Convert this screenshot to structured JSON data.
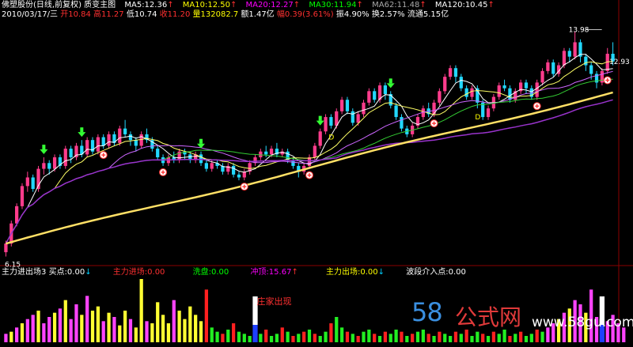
{
  "header": {
    "title": "佛塑股份(日线,前复权) 质变主图",
    "ma5": "MA5:12.36",
    "ma10": "MA10:12.50",
    "ma20": "MA20:12.27",
    "ma30": "MA30:11.94",
    "ma62": "MA62:11.48",
    "ma120": "MA120:10.45",
    "up_arrow": "↑",
    "colors": {
      "ma5": "#ffffff",
      "ma10": "#ffff00",
      "ma20": "#ff00ff",
      "ma30": "#00ff00",
      "ma62": "#888888",
      "ma120": "#ffffff"
    }
  },
  "quote": {
    "date": "2010/03/17/三",
    "open": "开10.84",
    "high": "高11.27",
    "low": "低10.74",
    "close": "收11.20",
    "volume": "量132082.7",
    "amount": "额1.47亿",
    "change": "幅0.39(3.61%)",
    "amplitude": "振4.90%",
    "turnover": "换2.57%",
    "float": "流通5.15亿"
  },
  "indicator": {
    "name": "主力进出场3",
    "buy": "买点:0.00",
    "main_in": "主力进场:0.00",
    "wash": "洗盘:0.00",
    "rush": "冲顶:15.67",
    "main_out": "主力出场:0.00",
    "band": "波段介入点:0.00",
    "down_arrow": "↓",
    "up_arrow": "↑",
    "annotation": "庄家出现",
    "colors": {
      "main_in": "#ff3030",
      "wash": "#00ff00",
      "rush": "#ff00ff",
      "main_out": "#ffff00",
      "band": "#ffffff"
    }
  },
  "watermark": {
    "num": "58",
    "cn": "公式网",
    "url": "www.58gu.com"
  },
  "chart_data": {
    "type": "candlestick",
    "price_labels": {
      "high": "13.98",
      "last": "12.93",
      "low": "6.15"
    },
    "marker_letter": "D",
    "ylim": [
      6.0,
      14.3
    ],
    "candles": [
      [
        6.3,
        6.6,
        6.15,
        6.7
      ],
      [
        6.6,
        7.3,
        6.5,
        7.4
      ],
      [
        7.3,
        7.9,
        7.2,
        8.0
      ],
      [
        7.9,
        8.6,
        7.8,
        8.7
      ],
      [
        8.6,
        8.9,
        8.4,
        9.1
      ],
      [
        8.9,
        8.5,
        8.4,
        9.0
      ],
      [
        8.5,
        9.2,
        8.4,
        9.3
      ],
      [
        9.2,
        9.4,
        9.0,
        9.6
      ],
      [
        9.4,
        9.2,
        9.0,
        9.5
      ],
      [
        9.2,
        9.6,
        9.1,
        9.7
      ],
      [
        9.6,
        9.3,
        9.2,
        9.7
      ],
      [
        9.3,
        9.9,
        9.2,
        10.0
      ],
      [
        9.9,
        9.6,
        9.4,
        10.0
      ],
      [
        9.6,
        10.0,
        9.5,
        10.1
      ],
      [
        10.0,
        9.7,
        9.6,
        10.2
      ],
      [
        9.7,
        10.2,
        9.6,
        10.3
      ],
      [
        10.2,
        9.8,
        9.7,
        10.3
      ],
      [
        9.8,
        10.3,
        9.7,
        10.4
      ],
      [
        10.3,
        10.0,
        9.9,
        10.4
      ],
      [
        10.0,
        10.4,
        9.9,
        10.5
      ],
      [
        10.4,
        10.1,
        10.0,
        10.5
      ],
      [
        10.1,
        10.6,
        10.0,
        10.7
      ],
      [
        10.6,
        10.4,
        10.3,
        10.9
      ],
      [
        10.4,
        10.2,
        10.0,
        10.5
      ],
      [
        10.2,
        10.0,
        9.8,
        10.3
      ],
      [
        10.0,
        10.4,
        9.9,
        10.5
      ],
      [
        10.4,
        10.2,
        10.1,
        10.6
      ],
      [
        10.2,
        9.9,
        9.8,
        10.3
      ],
      [
        9.9,
        9.6,
        9.5,
        10.0
      ],
      [
        9.6,
        9.4,
        9.3,
        9.7
      ],
      [
        9.4,
        9.6,
        9.3,
        9.7
      ],
      [
        9.6,
        9.5,
        9.4,
        9.8
      ],
      [
        9.5,
        9.8,
        9.4,
        9.9
      ],
      [
        9.8,
        9.7,
        9.5,
        9.9
      ],
      [
        9.7,
        9.5,
        9.4,
        9.8
      ],
      [
        9.5,
        9.7,
        9.4,
        9.8
      ],
      [
        9.7,
        9.4,
        9.3,
        9.8
      ],
      [
        9.4,
        9.2,
        9.1,
        9.5
      ],
      [
        9.2,
        9.4,
        9.1,
        9.5
      ],
      [
        9.4,
        9.3,
        9.2,
        9.5
      ],
      [
        9.3,
        9.1,
        9.0,
        9.4
      ],
      [
        9.1,
        9.3,
        9.0,
        9.4
      ],
      [
        9.3,
        9.0,
        8.9,
        9.4
      ],
      [
        9.0,
        8.9,
        8.8,
        9.1
      ],
      [
        8.9,
        9.1,
        8.8,
        9.2
      ],
      [
        9.1,
        9.4,
        9.0,
        9.5
      ],
      [
        9.4,
        9.6,
        9.3,
        9.7
      ],
      [
        9.6,
        9.8,
        9.5,
        9.9
      ],
      [
        9.8,
        9.7,
        9.6,
        10.0
      ],
      [
        9.7,
        9.9,
        9.6,
        10.0
      ],
      [
        9.9,
        9.7,
        9.6,
        10.1
      ],
      [
        9.7,
        9.8,
        9.6,
        9.9
      ],
      [
        9.8,
        9.5,
        9.4,
        9.9
      ],
      [
        9.5,
        9.3,
        9.2,
        9.6
      ],
      [
        9.3,
        9.1,
        8.9,
        9.4
      ],
      [
        9.1,
        9.3,
        9.0,
        9.4
      ],
      [
        9.3,
        9.6,
        9.2,
        9.7
      ],
      [
        9.6,
        10.0,
        9.5,
        10.1
      ],
      [
        10.0,
        10.5,
        9.9,
        10.6
      ],
      [
        10.5,
        11.0,
        10.4,
        11.1
      ],
      [
        11.0,
        10.7,
        10.6,
        11.1
      ],
      [
        10.7,
        11.2,
        10.6,
        11.3
      ],
      [
        11.2,
        11.6,
        11.1,
        11.7
      ],
      [
        11.6,
        11.2,
        11.1,
        11.7
      ],
      [
        11.2,
        10.8,
        10.7,
        11.3
      ],
      [
        10.8,
        11.1,
        10.7,
        11.2
      ],
      [
        11.1,
        11.5,
        11.0,
        11.6
      ],
      [
        11.5,
        11.9,
        11.4,
        12.0
      ],
      [
        11.9,
        11.6,
        11.5,
        12.0
      ],
      [
        11.6,
        12.1,
        11.5,
        12.2
      ],
      [
        12.1,
        11.8,
        11.6,
        12.2
      ],
      [
        11.8,
        11.4,
        11.3,
        11.9
      ],
      [
        11.4,
        11.0,
        10.9,
        11.5
      ],
      [
        11.0,
        10.6,
        10.5,
        11.1
      ],
      [
        10.6,
        10.4,
        10.3,
        10.7
      ],
      [
        10.4,
        10.7,
        10.3,
        10.8
      ],
      [
        10.7,
        11.0,
        10.6,
        11.1
      ],
      [
        11.0,
        11.3,
        10.9,
        11.4
      ],
      [
        11.3,
        11.1,
        11.0,
        11.5
      ],
      [
        11.1,
        11.5,
        11.0,
        11.6
      ],
      [
        11.5,
        11.9,
        11.4,
        12.0
      ],
      [
        11.9,
        12.4,
        11.8,
        12.5
      ],
      [
        12.4,
        12.7,
        12.3,
        12.8
      ],
      [
        12.7,
        12.4,
        12.2,
        12.8
      ],
      [
        12.4,
        12.0,
        11.9,
        12.5
      ],
      [
        12.0,
        11.7,
        11.6,
        12.1
      ],
      [
        11.7,
        12.0,
        11.6,
        12.1
      ],
      [
        12.0,
        11.5,
        11.3,
        12.1
      ],
      [
        11.5,
        11.0,
        10.9,
        11.6
      ],
      [
        11.0,
        11.3,
        10.9,
        11.4
      ],
      [
        11.3,
        11.7,
        11.2,
        11.8
      ],
      [
        11.7,
        12.1,
        11.6,
        12.2
      ],
      [
        12.1,
        12.0,
        11.9,
        12.3
      ],
      [
        12.0,
        11.6,
        11.5,
        12.1
      ],
      [
        11.6,
        11.9,
        11.5,
        12.0
      ],
      [
        11.9,
        12.2,
        11.8,
        12.3
      ],
      [
        12.2,
        12.0,
        11.8,
        12.3
      ],
      [
        12.0,
        11.7,
        11.6,
        12.1
      ],
      [
        11.7,
        12.2,
        11.6,
        12.3
      ],
      [
        12.2,
        12.6,
        12.1,
        12.7
      ],
      [
        12.6,
        12.9,
        12.5,
        13.0
      ],
      [
        12.9,
        12.5,
        12.4,
        13.0
      ],
      [
        12.5,
        12.8,
        12.4,
        12.9
      ],
      [
        12.8,
        13.3,
        12.7,
        13.4
      ],
      [
        13.3,
        13.1,
        12.9,
        13.4
      ],
      [
        13.1,
        13.6,
        13.0,
        13.98
      ],
      [
        13.6,
        13.1,
        12.9,
        13.7
      ],
      [
        13.1,
        12.8,
        12.6,
        13.2
      ],
      [
        12.8,
        12.5,
        12.3,
        12.9
      ],
      [
        12.5,
        12.2,
        12.0,
        12.6
      ],
      [
        12.2,
        12.6,
        12.1,
        12.7
      ],
      [
        12.6,
        13.2,
        12.5,
        13.4
      ],
      [
        13.2,
        12.93,
        12.8,
        13.6
      ]
    ],
    "main_in_idx": [
      7,
      14,
      36,
      58,
      71
    ],
    "rush_idx": [
      66,
      80
    ],
    "volume_colors": [
      "magenta",
      "yellow",
      "magenta",
      "yellow",
      "magenta",
      "magenta",
      "yellow",
      "magenta",
      "magenta",
      "yellow",
      "magenta",
      "yellow",
      "magenta",
      "magenta",
      "yellow",
      "magenta",
      "yellow",
      "yellow",
      "magenta",
      "yellow",
      "magenta",
      "yellow",
      "yellow",
      "magenta",
      "yellow",
      "yellow",
      "magenta",
      "yellow",
      "yellow",
      "yellow",
      "yellow",
      "magenta",
      "yellow",
      "yellow",
      "yellow",
      "yellow",
      "yellow",
      "red",
      "green",
      "green",
      "red",
      "green",
      "red",
      "green",
      "green",
      "green",
      "red",
      "green",
      "red",
      "green",
      "green",
      "red",
      "green",
      "red",
      "green",
      "red",
      "green",
      "red",
      "green",
      "green",
      "red",
      "green",
      "green",
      "red",
      "green",
      "red",
      "green",
      "green",
      "red",
      "green",
      "red",
      "green",
      "green",
      "red",
      "green",
      "red",
      "green",
      "green",
      "red",
      "green",
      "red",
      "green",
      "green",
      "red",
      "green",
      "red",
      "green",
      "green",
      "red",
      "green",
      "red",
      "green",
      "green",
      "red",
      "green",
      "red",
      "green",
      "green",
      "red",
      "green",
      "magenta",
      "magenta",
      "yellow",
      "magenta",
      "yellow",
      "magenta",
      "magenta",
      "yellow",
      "magenta",
      "magenta",
      "yellow",
      "magenta",
      "magenta"
    ],
    "volume_values": [
      8,
      10,
      14,
      18,
      22,
      26,
      30,
      18,
      24,
      28,
      32,
      40,
      22,
      36,
      26,
      44,
      30,
      34,
      20,
      28,
      24,
      16,
      30,
      22,
      14,
      60,
      20,
      18,
      38,
      26,
      18,
      40,
      30,
      22,
      34,
      26,
      20,
      50,
      14,
      10,
      8,
      12,
      18,
      10,
      8,
      6,
      10,
      8,
      12,
      6,
      8,
      14,
      10,
      6,
      8,
      10,
      12,
      8,
      6,
      10,
      18,
      24,
      14,
      10,
      8,
      6,
      10,
      12,
      8,
      6,
      10,
      8,
      12,
      10,
      6,
      8,
      10,
      12,
      8,
      6,
      10,
      8,
      6,
      10,
      8,
      12,
      6,
      10,
      8,
      6,
      10,
      8,
      12,
      6,
      8,
      10,
      6,
      8,
      12,
      10,
      14,
      18,
      22,
      28,
      32,
      40,
      36,
      28,
      50,
      24,
      30,
      20,
      26,
      18,
      14
    ]
  }
}
